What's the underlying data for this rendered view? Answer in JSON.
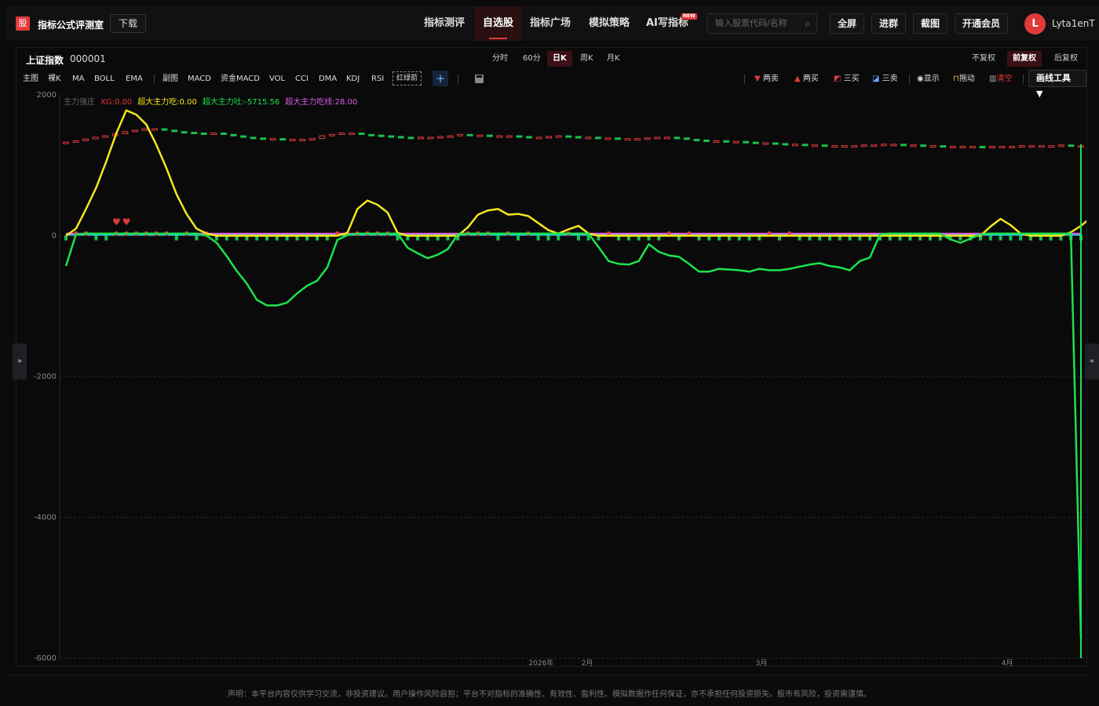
{
  "app": {
    "logo_char": "股",
    "title": "指标公式评测室",
    "download_label": "下载"
  },
  "nav": {
    "tabs": [
      "指标测评",
      "自选股",
      "指标广场",
      "模拟策略",
      "AI写指标"
    ],
    "active_tab": "自选股",
    "new_badge": "NEW"
  },
  "search": {
    "placeholder": "输入股票代码/名称"
  },
  "toolbar": {
    "fullscreen": "全屏",
    "join_group": "进群",
    "screenshot": "截图",
    "membership": "开通会员"
  },
  "user": {
    "initial": "L",
    "name": "Lyta1enT"
  },
  "symbol": {
    "name": "上证指数",
    "code": "000001"
  },
  "periods": [
    "分时",
    "60分",
    "日K",
    "周K",
    "月K"
  ],
  "active_period": "日K",
  "adjustments": [
    "不复权",
    "前复权",
    "后复权"
  ],
  "active_adjustment": "前复权",
  "main_indicators": [
    "主图",
    "裸K",
    "MA",
    "BOLL",
    "EMA"
  ],
  "sub_indicators": [
    "副图",
    "MACD",
    "资金MACD",
    "VOL",
    "CCI",
    "DMA",
    "KDJ",
    "RSI"
  ],
  "custom_indicator": "红绿箭",
  "signals": {
    "two_sell": "两卖",
    "two_buy": "两买",
    "three_buy": "三买",
    "three_sell": "三卖",
    "show": "显示",
    "drag": "拖动",
    "clear": "清空",
    "draw_tools": "画线工具 ▼"
  },
  "colors": {
    "accent_red": "#e23a3a",
    "yellow_line": "#f5e61b",
    "green_line": "#1be34d",
    "magenta_line": "#e25be6",
    "cyan_line": "#27c6d6",
    "candle_up": "#e23a3a",
    "candle_down": "#19c24a"
  },
  "chart_data": {
    "type": "line",
    "legend": [
      {
        "label": "主力强庄",
        "color": "#666666"
      },
      {
        "label": "XG:0.00",
        "color": "#e23a3a"
      },
      {
        "label": "超大主力吃:0.00",
        "color": "#f5e61b"
      },
      {
        "label": "超大主力吐:-5715.56",
        "color": "#1be34d"
      },
      {
        "label": "超大主力吃线:28.00",
        "color": "#e25be6"
      }
    ],
    "y_ticks": [
      2000,
      0,
      -2000,
      -4000,
      -6000
    ],
    "ylim": [
      -6000,
      2000
    ],
    "x_labels": [
      "2026年",
      "2月",
      "3月",
      "4月"
    ],
    "yellow": [
      0,
      100,
      380,
      680,
      1050,
      1450,
      1780,
      1720,
      1580,
      1290,
      960,
      590,
      310,
      100,
      30,
      0,
      0,
      0,
      0,
      0,
      0,
      0,
      0,
      0,
      0,
      0,
      0,
      0,
      40,
      380,
      500,
      440,
      330,
      40,
      0,
      0,
      0,
      0,
      0,
      0,
      120,
      300,
      360,
      380,
      300,
      310,
      280,
      180,
      80,
      30,
      90,
      140,
      30,
      0,
      0,
      0,
      0,
      0,
      0,
      0,
      0,
      0,
      0,
      0,
      0,
      0,
      0,
      0,
      0,
      0,
      0,
      0,
      0,
      0,
      0,
      0,
      0,
      0,
      0,
      0,
      0,
      0,
      0,
      0,
      0,
      0,
      0,
      0,
      0,
      0,
      0,
      0,
      130,
      240,
      150,
      30,
      0,
      0,
      0,
      0,
      50,
      140,
      260,
      280,
      30,
      0
    ],
    "green": [
      -430,
      20,
      30,
      30,
      30,
      30,
      30,
      30,
      30,
      30,
      30,
      30,
      30,
      30,
      0,
      -100,
      -290,
      -500,
      -680,
      -910,
      -990,
      -990,
      -950,
      -820,
      -710,
      -640,
      -450,
      -60,
      10,
      30,
      30,
      30,
      30,
      30,
      -170,
      -250,
      -320,
      -270,
      -190,
      20,
      30,
      30,
      30,
      30,
      30,
      30,
      30,
      30,
      30,
      30,
      30,
      30,
      30,
      -160,
      -360,
      -400,
      -410,
      -360,
      -120,
      -230,
      -280,
      -300,
      -400,
      -510,
      -510,
      -470,
      -480,
      -490,
      -510,
      -470,
      -490,
      -490,
      -470,
      -440,
      -410,
      -390,
      -430,
      -450,
      -490,
      -360,
      -310,
      20,
      30,
      30,
      30,
      30,
      30,
      30,
      -50,
      -100,
      -40,
      20,
      30,
      30,
      30,
      30,
      30,
      30,
      30,
      30,
      30,
      -5715.56
    ],
    "red_markers": [
      1,
      2,
      5,
      6,
      7,
      8,
      9,
      10,
      12,
      14,
      27,
      28,
      29,
      30,
      31,
      32,
      40,
      41,
      42,
      44,
      46,
      50,
      54,
      60,
      62,
      70,
      72
    ],
    "hearts": [
      5,
      6
    ],
    "candles_close": [
      1330,
      1350,
      1375,
      1400,
      1420,
      1450,
      1480,
      1500,
      1520,
      1520,
      1500,
      1480,
      1470,
      1460,
      1450,
      1460,
      1440,
      1420,
      1400,
      1390,
      1380,
      1380,
      1370,
      1370,
      1370,
      1380,
      1420,
      1440,
      1460,
      1460,
      1440,
      1430,
      1420,
      1410,
      1400,
      1390,
      1400,
      1400,
      1410,
      1420,
      1440,
      1430,
      1430,
      1420,
      1420,
      1420,
      1410,
      1400,
      1400,
      1410,
      1420,
      1410,
      1400,
      1400,
      1390,
      1390,
      1380,
      1380,
      1380,
      1390,
      1400,
      1400,
      1390,
      1370,
      1360,
      1350,
      1350,
      1340,
      1340,
      1330,
      1320,
      1320,
      1310,
      1300,
      1300,
      1290,
      1290,
      1280,
      1280,
      1280,
      1280,
      1290,
      1290,
      1300,
      1300,
      1290,
      1290,
      1280,
      1280,
      1270,
      1270,
      1270,
      1270,
      1260,
      1270,
      1270,
      1270,
      1280,
      1280,
      1280,
      1280,
      1290,
      1280,
      1280
    ]
  },
  "disclaimer": "声明：本平台内容仅供学习交流，非投资建议。用户操作风险自担；平台不对指标的准确性、有效性、盈利性、模拟数据作任何保证，亦不承担任何投资损失。股市有风险，投资需谨慎。"
}
